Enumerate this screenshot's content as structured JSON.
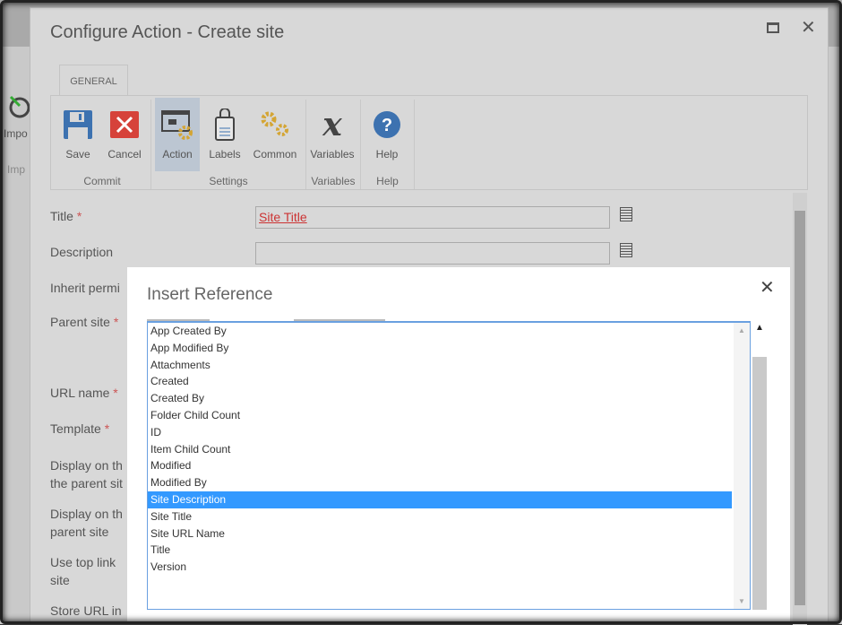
{
  "background": {
    "import_label": "Impo",
    "import_group": "Imp"
  },
  "dialog": {
    "title": "Configure Action - Create site",
    "tab": "GENERAL",
    "ribbon": {
      "buttons": {
        "save": "Save",
        "cancel": "Cancel",
        "action": "Action",
        "labels": "Labels",
        "common": "Common",
        "variables": "Variables",
        "help": "Help"
      },
      "groups": {
        "commit": "Commit",
        "settings": "Settings",
        "variables": "Variables",
        "help": "Help"
      }
    },
    "fields": [
      {
        "label": "Title",
        "required": "*",
        "value": "Site Title"
      },
      {
        "label": "Description",
        "required": "",
        "value": ""
      },
      {
        "label": "Inherit permi",
        "required": ""
      },
      {
        "label": "Parent site",
        "required": "*"
      },
      {
        "label": "URL name",
        "required": "*"
      },
      {
        "label": "Template",
        "required": "*"
      },
      {
        "label": "Display on th the parent sit",
        "required": ""
      },
      {
        "label": "Display on th parent site",
        "required": ""
      },
      {
        "label": "Use top link site",
        "required": ""
      },
      {
        "label": "Store URL in",
        "required": ""
      }
    ]
  },
  "insert_reference": {
    "title": "Insert Reference",
    "selected": "Site Description",
    "items": [
      "App Created By",
      "App Modified By",
      "Attachments",
      "Created",
      "Created By",
      "Folder Child Count",
      "ID",
      "Item Child Count",
      "Modified",
      "Modified By",
      "Site Description",
      "Site Title",
      "Site URL Name",
      "Title",
      "Version"
    ]
  }
}
